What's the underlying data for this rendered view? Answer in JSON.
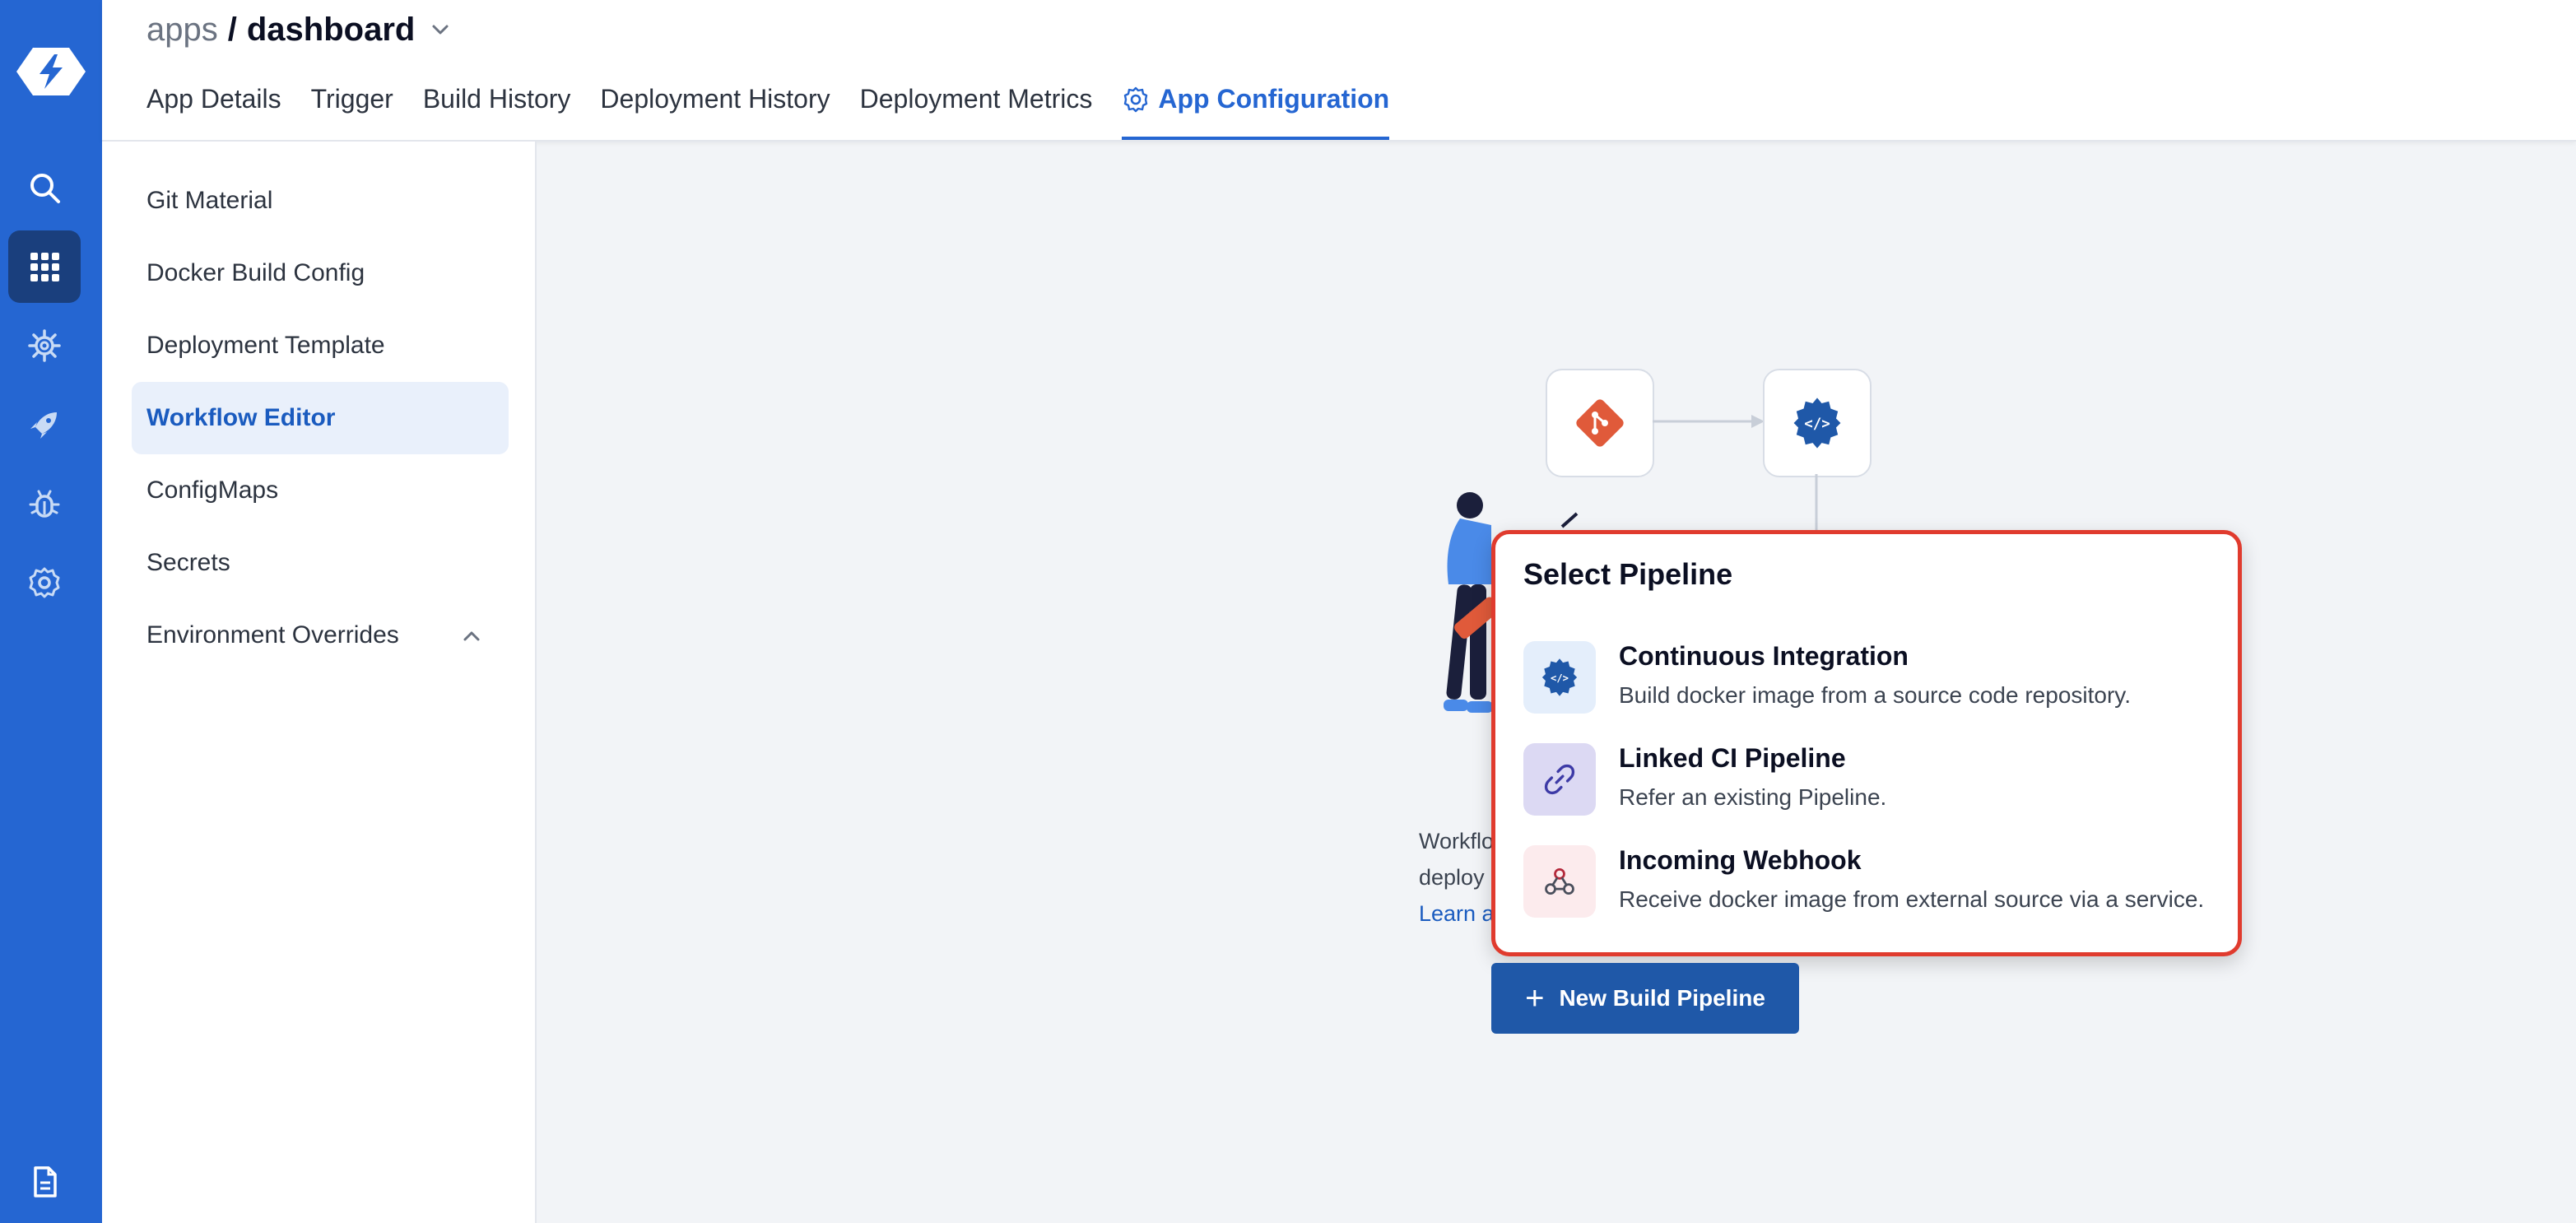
{
  "breadcrumb": {
    "parent": "apps",
    "separator": "/",
    "current": "dashboard"
  },
  "tabs": [
    {
      "label": "App Details"
    },
    {
      "label": "Trigger"
    },
    {
      "label": "Build History"
    },
    {
      "label": "Deployment History"
    },
    {
      "label": "Deployment Metrics"
    },
    {
      "label": "App Configuration",
      "active": true
    }
  ],
  "sidebar": {
    "items": [
      {
        "label": "Git Material"
      },
      {
        "label": "Docker Build Config"
      },
      {
        "label": "Deployment Template"
      },
      {
        "label": "Workflow Editor",
        "active": true
      },
      {
        "label": "ConfigMaps"
      },
      {
        "label": "Secrets"
      },
      {
        "label": "Environment Overrides",
        "expanded": true
      }
    ]
  },
  "rail": {
    "icons": [
      "devtron-logo-icon",
      "search-icon",
      "apps-grid-icon",
      "chart-store-icon",
      "deploy-rocket-icon",
      "security-bug-icon",
      "global-config-gear-icon",
      "docs-icon"
    ]
  },
  "empty_state": {
    "line1": "Workflo",
    "line2": "deploy",
    "link": "Learn a"
  },
  "select_pipeline": {
    "title": "Select Pipeline",
    "options": [
      {
        "title": "Continuous Integration",
        "description": "Build docker image from a source code repository.",
        "icon": "ci-gear-code-icon"
      },
      {
        "title": "Linked CI Pipeline",
        "description": "Refer an existing Pipeline.",
        "icon": "link-icon"
      },
      {
        "title": "Incoming Webhook",
        "description": "Receive docker image from external source via a service.",
        "icon": "webhook-icon"
      }
    ]
  },
  "new_button": {
    "plus": "+",
    "label": "New Build Pipeline"
  },
  "colors": {
    "rail": "#2566d2",
    "accent": "#2566d2",
    "button": "#1f58a8",
    "popup_border": "#e03b2e",
    "git": "#e05a3a"
  }
}
